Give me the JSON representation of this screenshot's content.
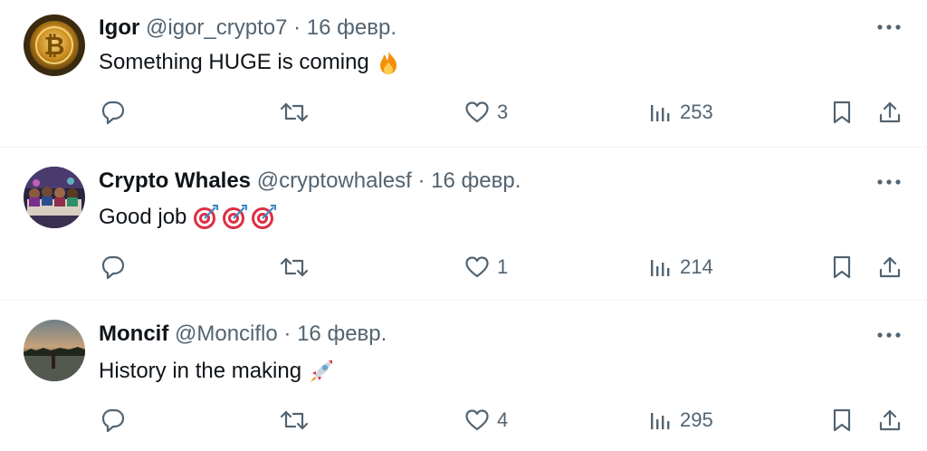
{
  "tweets": [
    {
      "author": "Igor",
      "handle": "@igor_crypto7",
      "separator": "·",
      "date": "16 февр.",
      "text": "Something HUGE is coming",
      "emoji": [
        "fire-emoji"
      ],
      "likes": "3",
      "views": "253"
    },
    {
      "author": "Crypto Whales",
      "handle": "@cryptowhalesf",
      "separator": "·",
      "date": "16 февр.",
      "text": "Good job",
      "emoji": [
        "direct-hit-emoji",
        "direct-hit-emoji",
        "direct-hit-emoji"
      ],
      "likes": "1",
      "views": "214"
    },
    {
      "author": "Moncif",
      "handle": "@Monciflo",
      "separator": "·",
      "date": "16 февр.",
      "text": "History in the making",
      "emoji": [
        "rocket-emoji"
      ],
      "likes": "4",
      "views": "295"
    }
  ],
  "icons": {
    "more": "more-horizontal-icon",
    "reply": "reply-bubble-icon",
    "repost": "repost-arrows-icon",
    "like": "heart-icon",
    "views": "views-bar-chart-icon",
    "bookmark": "bookmark-icon",
    "share": "share-upload-icon"
  },
  "colors": {
    "text": "#0f1419",
    "secondary": "#536471",
    "divider": "#eff3f4"
  }
}
